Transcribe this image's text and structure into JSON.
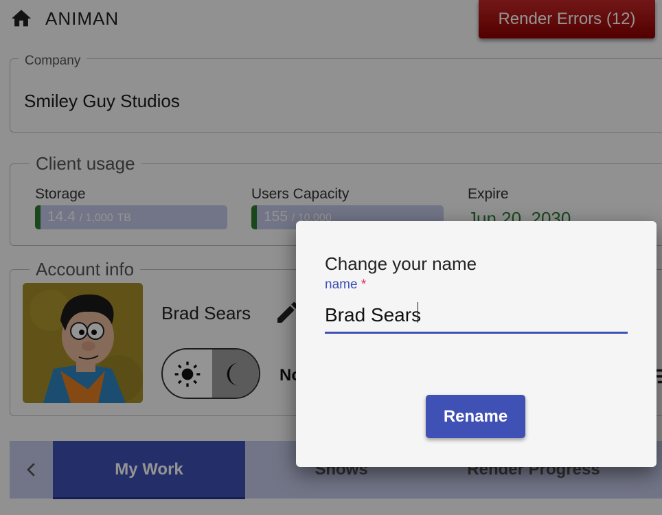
{
  "header": {
    "app_title": "ANIMAN",
    "home_icon": "home-icon",
    "render_errors_label": "Render Errors (12)"
  },
  "company": {
    "legend": "Company",
    "value": "Smiley Guy Studios"
  },
  "client_usage": {
    "legend": "Client usage",
    "storage": {
      "label": "Storage",
      "used": "14.4",
      "capacity": "/ 1,000",
      "unit": "TB",
      "fraction": 0.0144
    },
    "users": {
      "label": "Users Capacity",
      "used": "155",
      "capacity": "/ 10,000",
      "fraction": 0.0155
    },
    "expire": {
      "label": "Expire",
      "value": "Jun 20, 2030"
    }
  },
  "account": {
    "legend": "Account info",
    "name": "Brad Sears",
    "edit_icon": "pencil-icon",
    "light_icon": "sun-icon",
    "dark_icon": "moon-icon",
    "notification_label": "No",
    "filter_icon": "filter-icon"
  },
  "tabs": {
    "scroll_left_icon": "chevron-left-icon",
    "items": [
      {
        "label": "My Work",
        "active": true
      },
      {
        "label": "Shows",
        "active": false
      },
      {
        "label": "Render Progress",
        "active": false
      }
    ]
  },
  "dialog": {
    "title": "Change your name",
    "field_label": "name",
    "required_mark": "*",
    "field_value": "Brad Sears",
    "button_label": "Rename"
  },
  "colors": {
    "primary": "#3f51b5",
    "error": "#c62828",
    "success": "#2e7d32"
  }
}
